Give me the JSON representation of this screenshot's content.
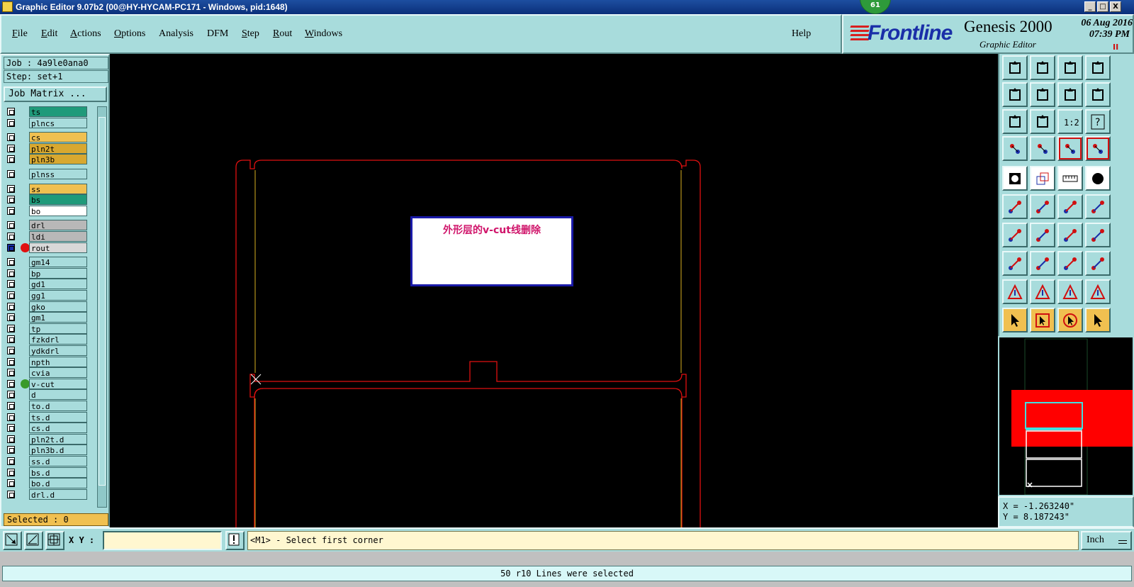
{
  "window": {
    "title": "Graphic Editor 9.07b2 (00@HY-HYCAM-PC171 - Windows, pid:1648)",
    "badge": "61",
    "buttons": [
      "_",
      "□",
      "X"
    ]
  },
  "menu": {
    "items": [
      {
        "pre": "",
        "u": "F",
        "post": "ile"
      },
      {
        "pre": "",
        "u": "E",
        "post": "dit"
      },
      {
        "pre": "",
        "u": "A",
        "post": "ctions"
      },
      {
        "pre": "",
        "u": "O",
        "post": "ptions"
      },
      {
        "pre": "",
        "u": "",
        "post": "Analysis"
      },
      {
        "pre": "",
        "u": "",
        "post": "DFM"
      },
      {
        "pre": "",
        "u": "S",
        "post": "tep"
      },
      {
        "pre": "",
        "u": "R",
        "post": "out"
      },
      {
        "pre": "",
        "u": "W",
        "post": "indows"
      }
    ],
    "help": "Help"
  },
  "logo": {
    "brand": "Frontline",
    "product": "Genesis 2000",
    "subtitle": "Graphic Editor",
    "date": "06 Aug 2016",
    "time": "07:39 PM",
    "pause": "II"
  },
  "left": {
    "job": "Job : 4a9le0ana0",
    "step": "Step: set+1",
    "job_matrix": "Job Matrix ...",
    "selected": "Selected : 0",
    "layers": [
      {
        "name": "ts",
        "color": "#1f9a7a",
        "dot": ""
      },
      {
        "name": "plncs",
        "color": "#a8dcdc",
        "dot": ""
      },
      {
        "name": "cs",
        "color": "#f0c050",
        "dot": ""
      },
      {
        "name": "pln2t",
        "color": "#d8a830",
        "dot": ""
      },
      {
        "name": "pln3b",
        "color": "#d8a830",
        "dot": ""
      },
      {
        "name": "plnss",
        "color": "#a8dcdc",
        "dot": ""
      },
      {
        "name": "ss",
        "color": "#f0c050",
        "dot": ""
      },
      {
        "name": "bs",
        "color": "#1f9a7a",
        "dot": ""
      },
      {
        "name": "bo",
        "color": "#ffffff",
        "dot": ""
      },
      {
        "name": "drl",
        "color": "#b8b8b8",
        "dot": ""
      },
      {
        "name": "ldi",
        "color": "#b8b8b8",
        "dot": ""
      },
      {
        "name": "rout",
        "color": "#d8d8d8",
        "dot": "#e01010",
        "selected": true
      },
      {
        "name": "gm14",
        "color": "#a8dcdc",
        "dot": ""
      },
      {
        "name": "bp",
        "color": "#a8dcdc",
        "dot": ""
      },
      {
        "name": "gd1",
        "color": "#a8dcdc",
        "dot": ""
      },
      {
        "name": "gg1",
        "color": "#a8dcdc",
        "dot": ""
      },
      {
        "name": "gko",
        "color": "#a8dcdc",
        "dot": ""
      },
      {
        "name": "gm1",
        "color": "#a8dcdc",
        "dot": ""
      },
      {
        "name": "tp",
        "color": "#a8dcdc",
        "dot": ""
      },
      {
        "name": "fzkdrl",
        "color": "#a8dcdc",
        "dot": ""
      },
      {
        "name": "ydkdrl",
        "color": "#a8dcdc",
        "dot": ""
      },
      {
        "name": "npth",
        "color": "#a8dcdc",
        "dot": ""
      },
      {
        "name": "cvia",
        "color": "#a8dcdc",
        "dot": ""
      },
      {
        "name": "v-cut",
        "color": "#a8dcdc",
        "dot": "#3a9a2a"
      },
      {
        "name": "d",
        "color": "#a8dcdc",
        "dot": ""
      },
      {
        "name": "to.d",
        "color": "#a8dcdc",
        "dot": ""
      },
      {
        "name": "ts.d",
        "color": "#a8dcdc",
        "dot": ""
      },
      {
        "name": "cs.d",
        "color": "#a8dcdc",
        "dot": ""
      },
      {
        "name": "pln2t.d",
        "color": "#a8dcdc",
        "dot": ""
      },
      {
        "name": "pln3b.d",
        "color": "#a8dcdc",
        "dot": ""
      },
      {
        "name": "ss.d",
        "color": "#a8dcdc",
        "dot": ""
      },
      {
        "name": "bs.d",
        "color": "#a8dcdc",
        "dot": ""
      },
      {
        "name": "bo.d",
        "color": "#a8dcdc",
        "dot": ""
      },
      {
        "name": "drl.d",
        "color": "#a8dcdc",
        "dot": ""
      }
    ]
  },
  "canvas": {
    "annotation": "外形层的v-cut线删除"
  },
  "tools": {
    "ratio_label": "1:2",
    "help_label": "?"
  },
  "coords": {
    "x": "X = -1.263240\"",
    "y": "Y = 8.187243\""
  },
  "command": {
    "xy_label": "X Y :",
    "xy_value": "",
    "prompt": "<M1> - Select first corner",
    "units": "Inch"
  },
  "status": {
    "message": "50 r10 Lines were selected"
  }
}
